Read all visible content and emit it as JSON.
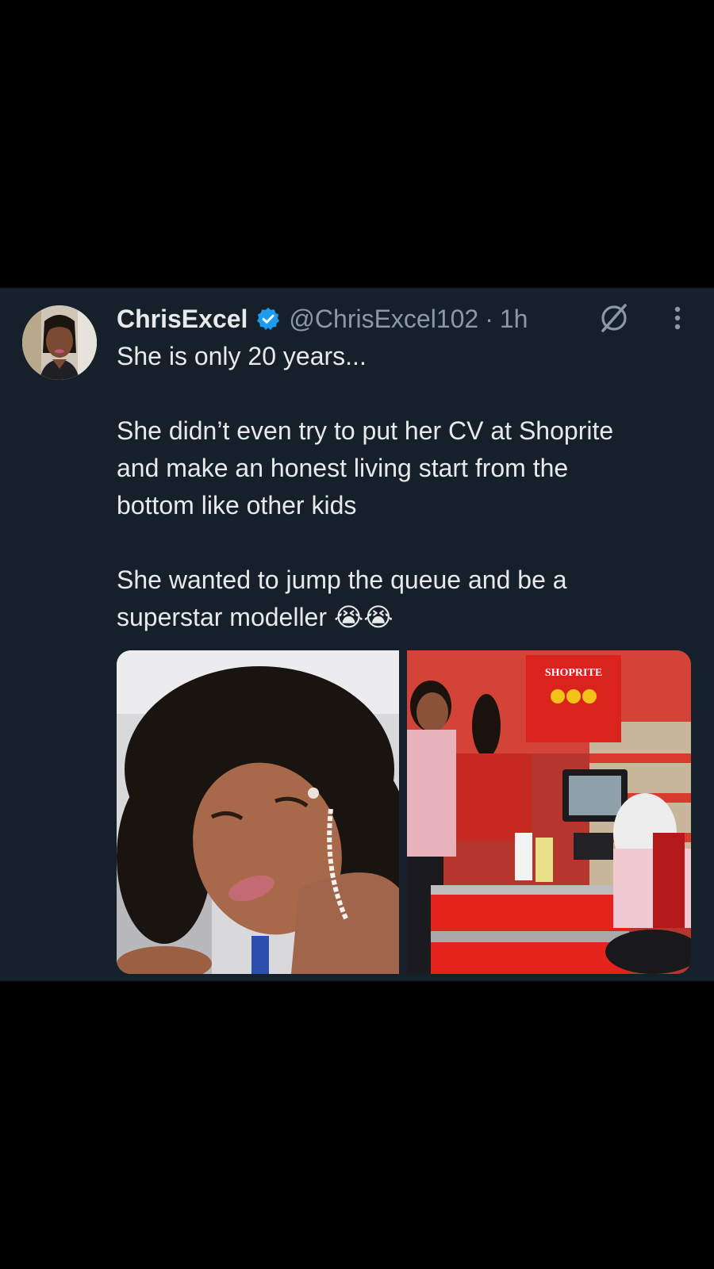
{
  "tweet": {
    "author_name": "ChrisExcel",
    "handle": "@ChrisExcel102",
    "separator": "·",
    "time": "1h",
    "verified": true,
    "lines": [
      "She is only 20 years...",
      "",
      "She didn’t even try to put her CV at Shoprite",
      "and make an honest living start from the",
      "bottom like other kids",
      "",
      "She wanted to jump the queue and be a",
      "superstar modeller 😭😭"
    ],
    "store_sign": "SHOPRITE",
    "icons": {
      "verified": "verified-badge-icon",
      "grok": "grok-icon",
      "more": "more-options-icon"
    },
    "colors": {
      "background": "#15202b",
      "text": "#e7e9ea",
      "muted": "#8b98a5",
      "verified": "#1d9bf0"
    }
  }
}
